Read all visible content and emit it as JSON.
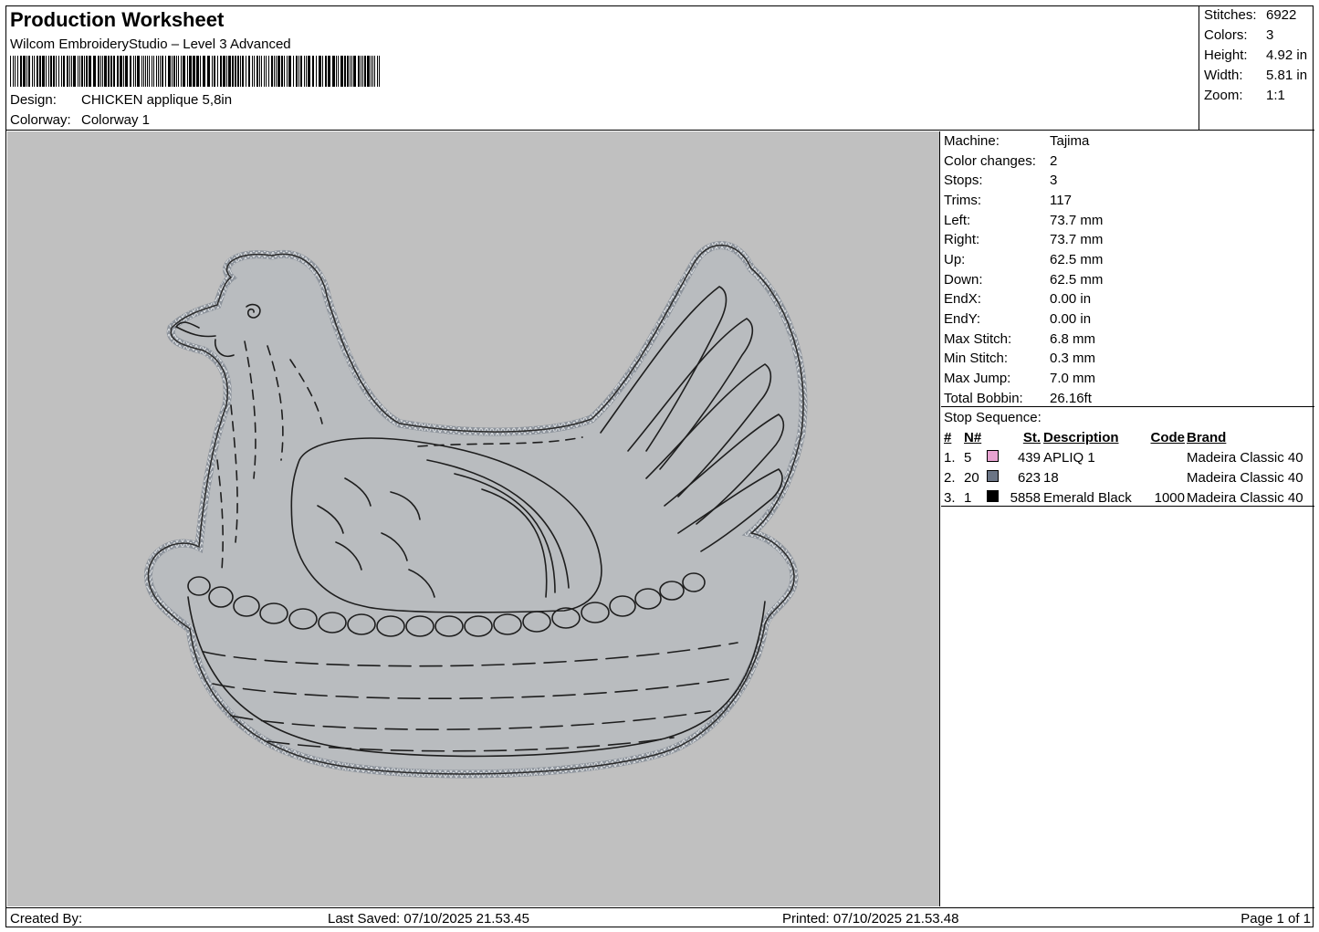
{
  "header": {
    "title": "Production Worksheet",
    "subtitle": "Wilcom EmbroideryStudio – Level 3 Advanced",
    "design_label": "Design:",
    "design_value": "CHICKEN applique 5,8in",
    "colorway_label": "Colorway:",
    "colorway_value": "Colorway 1"
  },
  "summary": [
    {
      "label": "Stitches:",
      "value": "6922"
    },
    {
      "label": "Colors:",
      "value": "3"
    },
    {
      "label": "Height:",
      "value": "4.92 in"
    },
    {
      "label": "Width:",
      "value": "5.81 in"
    },
    {
      "label": "Zoom:",
      "value": "1:1"
    }
  ],
  "machine": [
    {
      "label": "Machine:",
      "value": "Tajima"
    },
    {
      "label": "Color changes:",
      "value": "2"
    },
    {
      "label": "Stops:",
      "value": "3"
    },
    {
      "label": "Trims:",
      "value": "117"
    },
    {
      "label": "Left:",
      "value": "73.7 mm"
    },
    {
      "label": "Right:",
      "value": "73.7 mm"
    },
    {
      "label": "Up:",
      "value": "62.5 mm"
    },
    {
      "label": "Down:",
      "value": "62.5 mm"
    },
    {
      "label": "EndX:",
      "value": "0.00 in"
    },
    {
      "label": "EndY:",
      "value": "0.00 in"
    },
    {
      "label": "Max Stitch:",
      "value": "6.8 mm"
    },
    {
      "label": "Min Stitch:",
      "value": "0.3 mm"
    },
    {
      "label": "Max Jump:",
      "value": "7.0 mm"
    },
    {
      "label": "Total Bobbin:",
      "value": "26.16ft"
    }
  ],
  "stop_sequence": {
    "title": "Stop Sequence:",
    "columns": {
      "num": "#",
      "n": "N#",
      "st": "St.",
      "description": "Description",
      "code": "Code",
      "brand": "Brand"
    },
    "rows": [
      {
        "num": "1.",
        "n": "5",
        "color": "#e7a3d1",
        "st": "439",
        "description": "APLIQ 1",
        "code": "",
        "brand": "Madeira Classic 40"
      },
      {
        "num": "2.",
        "n": "20",
        "color": "#6b7585",
        "st": "623",
        "description": "18",
        "code": "",
        "brand": "Madeira Classic 40"
      },
      {
        "num": "3.",
        "n": "1",
        "color": "#000000",
        "st": "5858",
        "description": "Emerald Black",
        "code": "1000",
        "brand": "Madeira Classic 40"
      }
    ]
  },
  "footer": {
    "created": "Created By:",
    "saved": "Last Saved: 07/10/2025 21.53.45",
    "printed": "Printed: 07/10/2025 21.53.48",
    "page": "Page 1 of 1"
  },
  "colors": {
    "preview_bg": "#c0c0c0",
    "satin_border": "#9aa0a8",
    "outline": "#1e1e1e"
  }
}
